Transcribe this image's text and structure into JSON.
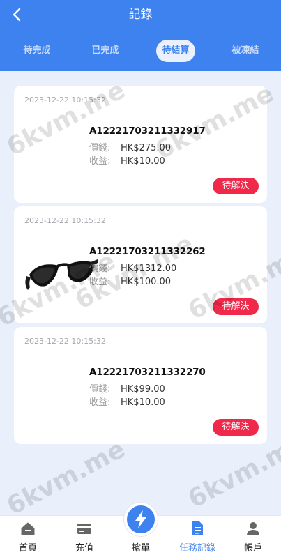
{
  "header": {
    "title": "記錄",
    "tabs": [
      {
        "label": "待完成"
      },
      {
        "label": "已完成"
      },
      {
        "label": "待結算",
        "active": true
      },
      {
        "label": "被凍結"
      }
    ]
  },
  "records": [
    {
      "time": "2023-12-22 10:15:32",
      "order": "A12221703211332917",
      "price_label": "價錢:",
      "price": "HK$275.00",
      "income_label": "收益:",
      "income": "HK$10.00",
      "status": "待解決",
      "has_image": false
    },
    {
      "time": "2023-12-22 10:15:32",
      "order": "A12221703211332262",
      "price_label": "價錢:",
      "price": "HK$1312.00",
      "income_label": "收益:",
      "income": "HK$100.00",
      "status": "待解決",
      "has_image": true
    },
    {
      "time": "2023-12-22 10:15:32",
      "order": "A12221703211332270",
      "price_label": "價錢:",
      "price": "HK$99.00",
      "income_label": "收益:",
      "income": "HK$10.00",
      "status": "待解決",
      "has_image": false
    }
  ],
  "watermark": "6kvm.me",
  "nav": [
    {
      "label": "首頁",
      "icon": "home-icon"
    },
    {
      "label": "充值",
      "icon": "card-icon"
    },
    {
      "label": "搶單",
      "icon": "lightning-icon"
    },
    {
      "label": "任務記錄",
      "icon": "document-icon",
      "active": true
    },
    {
      "label": "帳戶",
      "icon": "user-icon"
    }
  ],
  "colors": {
    "primary": "#3e82f0",
    "status": "#f0284a",
    "background": "#e9f0fb"
  }
}
